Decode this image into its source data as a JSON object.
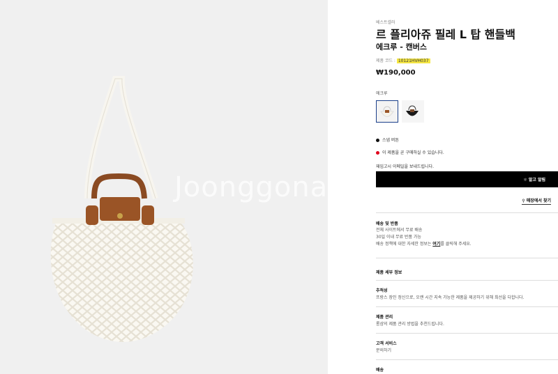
{
  "gallery": {
    "watermark": "Joonggonara"
  },
  "product": {
    "breadcrumb": "베스트셀러",
    "title": "르 플리아쥬 필레 L 탑 핸들백",
    "subtitle": "에크루 - 캔버스",
    "code_label": "제품 코드 :",
    "code": "10121HVH037",
    "price": "₩190,000"
  },
  "colors": {
    "label": "에크루",
    "options": [
      "에크루",
      "블랙"
    ]
  },
  "status": {
    "snap": "스냅 버튼",
    "availability": "이 제품을 곧 구매하실 수 있습니다.",
    "availability_color": "#e0001b",
    "restock_msg": "재입고시 이메일을 보내드립니다.",
    "alarm_button": "알고 알림",
    "store_finder": "매장에서 찾기"
  },
  "sections": {
    "shipping_title": "배송 및 반품",
    "shipping_line1": "전체 사이트에서 무료 배송",
    "shipping_line2": "30일 이내 무료 반품 가능",
    "shipping_line3_pre": "배송 정책에 대한 자세한 정보는 ",
    "shipping_line3_link": "여기",
    "shipping_line3_post": "를 클릭해 주세요.",
    "details_title": "제품 세부 정보",
    "trace_title": "추적성",
    "trace_text": "프랑스 장인 정신으로, 오랜 시간 지속 가능한 제품을 제공하기 위해 최선을 다합니다.",
    "care_title": "제품 관리",
    "care_text": "롱샴의 제품 관리 방법을 추천드립니다.",
    "service_title": "고객 서비스",
    "service_text": "문의하기",
    "delivery_title": "배송"
  }
}
